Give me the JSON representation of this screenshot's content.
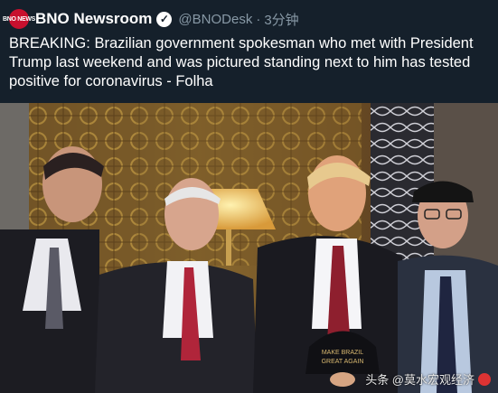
{
  "tweet": {
    "avatar_text": "BNO NEWS",
    "account_name": "BNO Newsroom",
    "handle": "@BNODesk",
    "separator": "·",
    "time": "3分钟",
    "text": "BREAKING: Brazilian government spokesman who met with President Trump last weekend and was pictured standing next to him has tested positive for coronavirus - Folha"
  },
  "photo": {
    "cap_text_line1": "MAKE BRAZIL",
    "cap_text_line2": "GREAT AGAIN",
    "watermark": "头条 @莫水宏观经济"
  },
  "colors": {
    "background": "#15202b",
    "secondary_text": "#8899a6",
    "avatar": "#c8102e"
  }
}
